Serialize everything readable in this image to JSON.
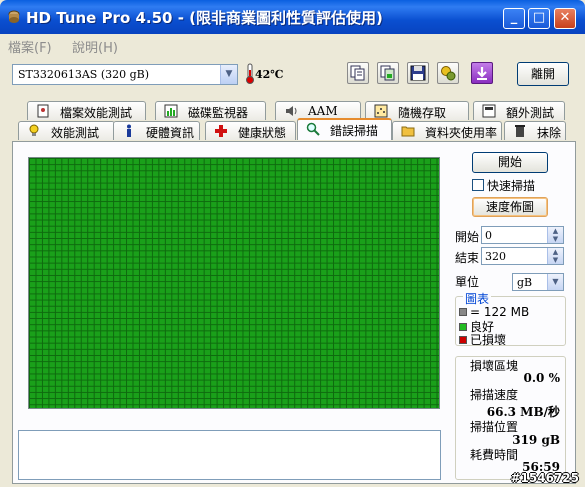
{
  "window": {
    "title": "HD Tune Pro 4.50 - (限非商業圖利性質評估使用)",
    "minimize": "_",
    "maximize": "□",
    "close": "✕"
  },
  "menu": {
    "file": "檔案(F)",
    "help": "說明(H)"
  },
  "toolbar": {
    "drive": "ST3320613AS (320 gB)",
    "temperature": "42℃",
    "exit_label": "離開",
    "icons": [
      "copy-text-icon",
      "copy-image-icon",
      "save-icon",
      "options-icon",
      "download-icon"
    ]
  },
  "tabs_row1": [
    {
      "label": "檔案效能測試",
      "icon": "file-benchmark-icon"
    },
    {
      "label": "磁碟監視器",
      "icon": "disk-monitor-icon"
    },
    {
      "label": "AAM",
      "icon": "speaker-icon"
    },
    {
      "label": "隨機存取",
      "icon": "random-access-icon"
    },
    {
      "label": "額外測試",
      "icon": "extra-tests-icon"
    }
  ],
  "tabs_row2": [
    {
      "label": "效能測試",
      "icon": "lightbulb-icon"
    },
    {
      "label": "硬體資訊",
      "icon": "info-icon"
    },
    {
      "label": "健康狀態",
      "icon": "health-cross-icon"
    },
    {
      "label": "錯誤掃描",
      "icon": "magnifier-icon",
      "active": true
    },
    {
      "label": "資料夾使用率",
      "icon": "folder-icon"
    },
    {
      "label": "抹除",
      "icon": "trash-icon"
    }
  ],
  "scan": {
    "start_button": "開始",
    "quick_scan_label": "快速掃描",
    "quick_scan_checked": false,
    "speed_map_button": "速度佈圖",
    "start_label": "開始",
    "start_value": "0",
    "end_label": "結束",
    "end_value": "320",
    "unit_label": "單位",
    "unit_value": "gB",
    "block_color_good": "#1aa01a"
  },
  "legend": {
    "title": "圖表",
    "items": [
      {
        "label": "= 122 MB",
        "color": "#888888"
      },
      {
        "label": "良好",
        "color": "#22bb22"
      },
      {
        "label": "已損壞",
        "color": "#cc0000"
      }
    ]
  },
  "stats": {
    "damaged_label": "損壞區塊",
    "damaged_value": "0.0 %",
    "speed_label": "掃描速度",
    "speed_value": "66.3 MB/秒",
    "position_label": "掃描位置",
    "position_value": "319 gB",
    "elapsed_label": "耗費時間",
    "elapsed_value": "56:59"
  },
  "watermark": "#1546725"
}
